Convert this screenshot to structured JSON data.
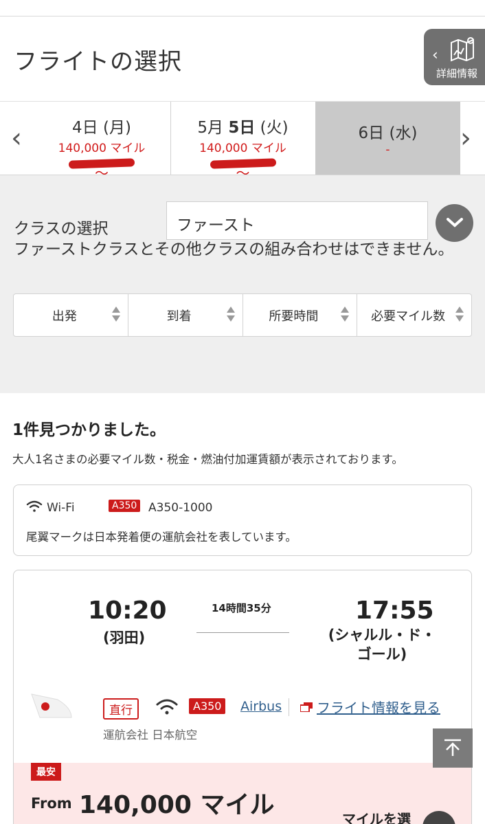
{
  "header": {
    "title": "フライトの選択",
    "detail_button_label": "詳細情報"
  },
  "date_tabs": [
    {
      "day_prefix": "",
      "day": "4日 (月)",
      "miles": "140,000 マイル",
      "tilde": "〜",
      "selected": false
    },
    {
      "day_prefix": "5月 ",
      "day": "5日",
      "weekday": " (火)",
      "miles": "140,000 マイル",
      "tilde": "〜",
      "selected": false
    },
    {
      "day": "6日 (水)",
      "miles": "-",
      "selected": true
    }
  ],
  "class_selection": {
    "label": "クラスの選択",
    "selected": "ファースト",
    "note": "ファーストクラスとその他クラスの組み合わせはできません。"
  },
  "sort_columns": [
    "出発",
    "到着",
    "所要時間",
    "必要マイル数"
  ],
  "results": {
    "count_text": "1件見つかりました。",
    "description": "大人1名さまの必要マイル数・税金・燃油付加運賃額が表示されております。"
  },
  "legend": {
    "wifi_label": "Wi-Fi",
    "aircraft_badge": "A350",
    "aircraft_model": "A350-1000",
    "note": "尾翼マークは日本発着便の運航会社を表しています。"
  },
  "flight": {
    "departure_time": "10:20",
    "departure_airport": "(羽田)",
    "duration": "14時間35分",
    "arrival_time": "17:55",
    "arrival_airport": "(シャルル・ド・ゴール)",
    "direct_label": "直行",
    "aircraft_badge": "A350",
    "manufacturer_link": "Airbus",
    "flight_info_link": "フライト情報を見る",
    "operator": "運航会社 日本航空",
    "cheapest_badge": "最安",
    "from_label": "From",
    "price": "140,000 マイル",
    "select_label": "マイルを選"
  },
  "colors": {
    "accent_red": "#cc1b1b",
    "link_blue": "#2f5e8c",
    "gray_bg": "#efefef",
    "price_bg": "#fde7e7"
  }
}
